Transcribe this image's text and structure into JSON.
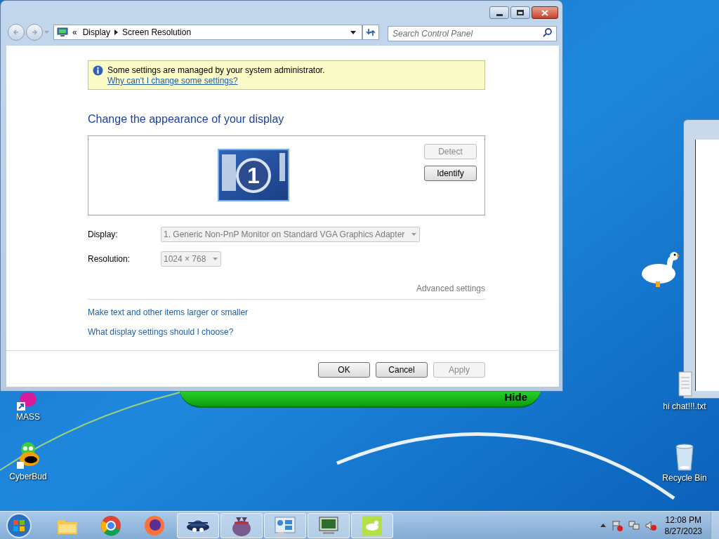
{
  "window": {
    "overflow_glyph": "«",
    "breadcrumb": [
      "Display",
      "Screen Resolution"
    ],
    "search": {
      "placeholder": "Search Control Panel"
    }
  },
  "notice": {
    "text": "Some settings are managed by your system administrator.",
    "link": "Why can't I change some settings?"
  },
  "heading": "Change the appearance of your display",
  "preview": {
    "monitor_number": "1",
    "buttons": [
      {
        "label": "Detect",
        "disabled": true
      },
      {
        "label": "Identify",
        "disabled": false
      }
    ]
  },
  "fields": [
    {
      "label": "Display:",
      "value": "1. Generic Non-PnP Monitor on Standard VGA Graphics Adapter",
      "disabled": true
    },
    {
      "label": "Resolution:",
      "value": "1024 × 768",
      "disabled": true
    }
  ],
  "advanced_link": {
    "label": "Advanced settings",
    "disabled": true
  },
  "links": [
    "Make text and other items larger or smaller",
    "What display settings should I choose?"
  ],
  "buttons": [
    {
      "label": "OK",
      "disabled": false
    },
    {
      "label": "Cancel",
      "disabled": false
    },
    {
      "label": "Apply",
      "disabled": true
    }
  ],
  "overlay_bar": {
    "label": "Hide"
  },
  "desktop_icons": [
    {
      "label": "MASS",
      "kind": "app"
    },
    {
      "label": "CyberBud",
      "kind": "bug"
    },
    {
      "label": "hi chat!!!.txt",
      "kind": "text"
    },
    {
      "label": "Recycle Bin",
      "kind": "bin"
    }
  ],
  "taskbar": {
    "apps": [
      {
        "kind": "folder",
        "open": false
      },
      {
        "kind": "chrome",
        "open": false
      },
      {
        "kind": "firefox",
        "open": false
      },
      {
        "kind": "hat",
        "open": true
      },
      {
        "kind": "bag",
        "open": true
      },
      {
        "kind": "panel",
        "open": true
      },
      {
        "kind": "monitor",
        "open": true
      },
      {
        "kind": "goose",
        "open": true
      }
    ],
    "time": "12:08 PM",
    "date": "8/27/2023"
  }
}
